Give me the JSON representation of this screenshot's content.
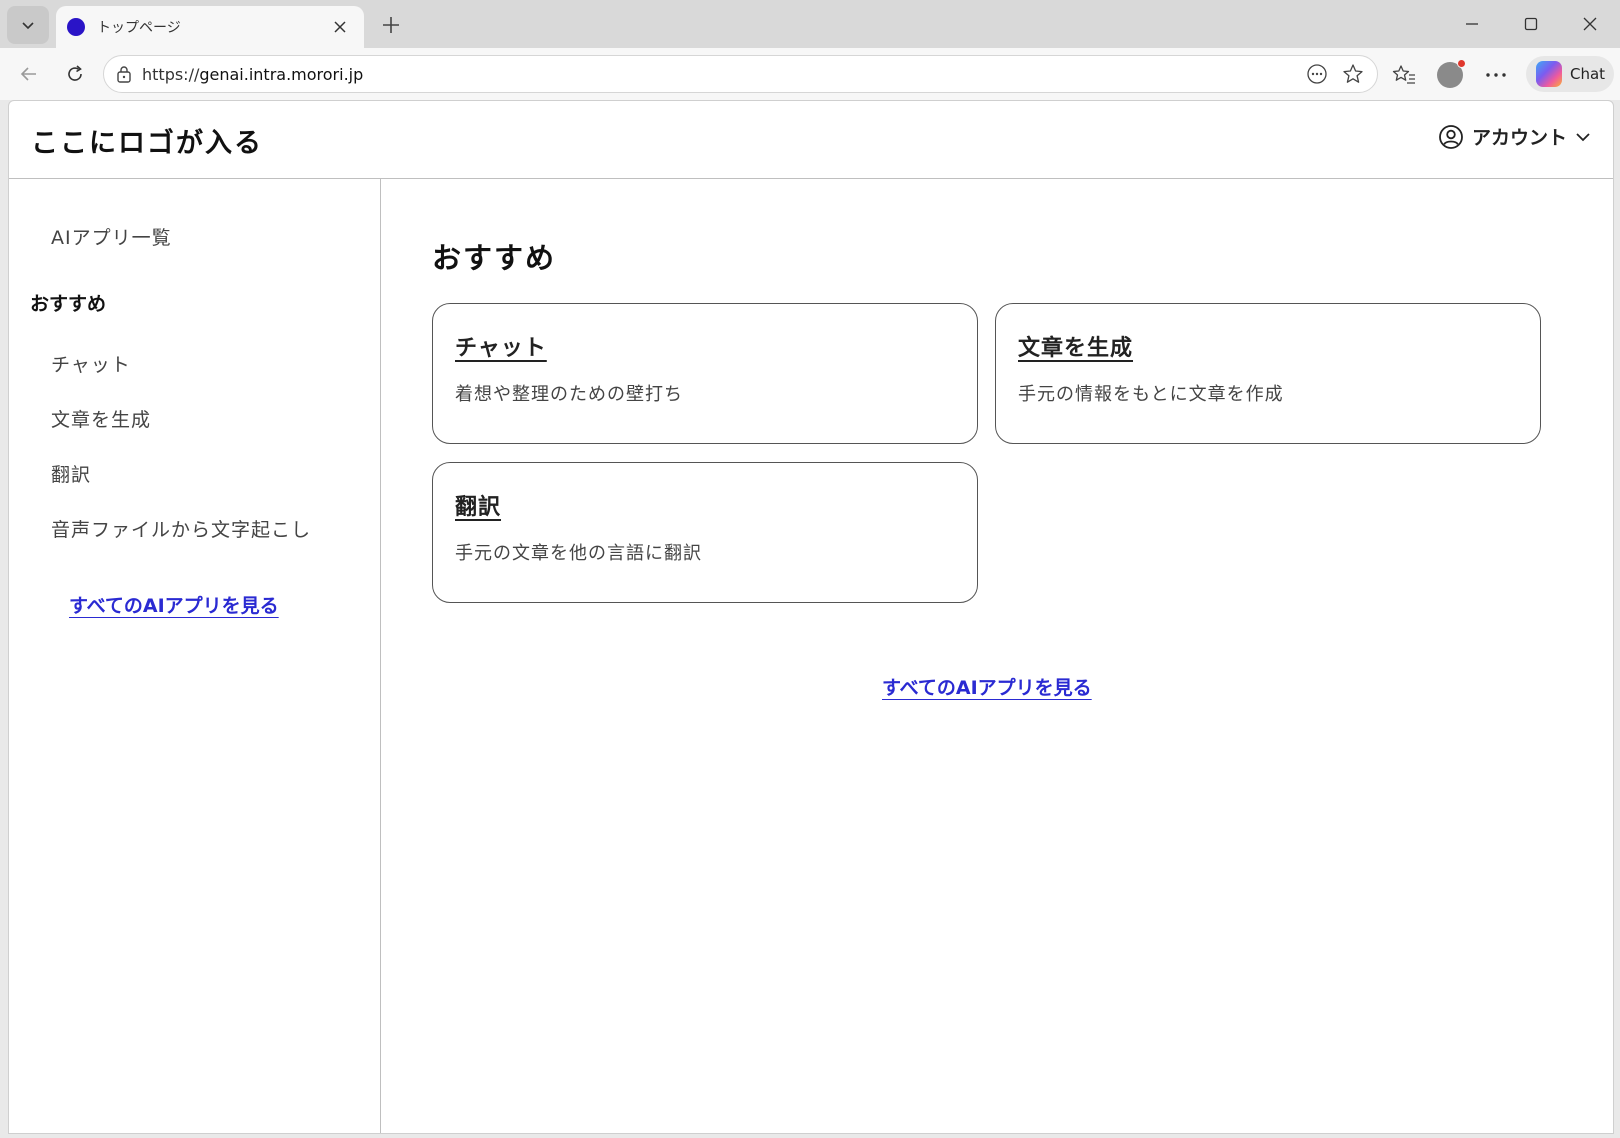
{
  "browser": {
    "tab": {
      "title": "トップページ",
      "favicon_color": "#2a14c7"
    },
    "address": {
      "scheme": "https://",
      "host": "genai.intra.morori.jp"
    },
    "copilot_label": "Chat"
  },
  "app": {
    "logo": "ここにロゴが入る",
    "account_label": "アカウント",
    "link_color": "#2a2ad2"
  },
  "sidebar": {
    "app_list_link": "AIアプリ一覧",
    "section_heading": "おすすめ",
    "items": [
      {
        "label": "チャット"
      },
      {
        "label": "文章を生成"
      },
      {
        "label": "翻訳"
      },
      {
        "label": "音声ファイルから文字起こし"
      }
    ],
    "see_all": "すべてのAIアプリを見る"
  },
  "main": {
    "title": "おすすめ",
    "cards": [
      {
        "title": "チャット",
        "description": "着想や整理のための壁打ち"
      },
      {
        "title": "文章を生成",
        "description": "手元の情報をもとに文章を作成"
      },
      {
        "title": "翻訳",
        "description": "手元の文章を他の言語に翻訳"
      }
    ],
    "see_all": "すべてのAIアプリを見る"
  }
}
